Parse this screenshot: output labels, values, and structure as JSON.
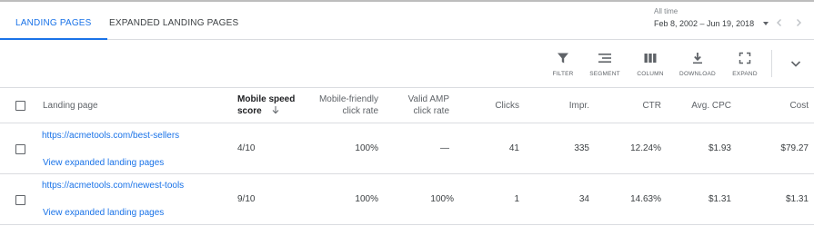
{
  "tabs": [
    {
      "label": "LANDING PAGES",
      "active": true
    },
    {
      "label": "EXPANDED LANDING PAGES",
      "active": false
    }
  ],
  "date_range": {
    "label": "All time",
    "value": "Feb 8, 2002 – Jun 19, 2018"
  },
  "toolbar": {
    "filter": "FILTER",
    "segment": "SEGMENT",
    "column": "COLUMN",
    "download": "DOWNLOAD",
    "expand": "EXPAND"
  },
  "table": {
    "headers": {
      "landing_page": "Landing page",
      "mobile_speed_line1": "Mobile speed",
      "mobile_speed_line2": "score",
      "mobile_friendly_line1": "Mobile-friendly",
      "mobile_friendly_line2": "click rate",
      "valid_amp_line1": "Valid AMP",
      "valid_amp_line2": "click rate",
      "clicks": "Clicks",
      "impr": "Impr.",
      "ctr": "CTR",
      "avg_cpc": "Avg. CPC",
      "cost": "Cost"
    },
    "rows": [
      {
        "url": "https://acmetools.com/best-sellers",
        "expand_link": "View expanded landing pages",
        "mobile_speed": "4/10",
        "mobile_friendly": "100%",
        "valid_amp": "—",
        "clicks": "41",
        "impr": "335",
        "ctr": "12.24%",
        "avg_cpc": "$1.93",
        "cost": "$79.27"
      },
      {
        "url": "https://acmetools.com/newest-tools",
        "expand_link": "View expanded landing pages",
        "mobile_speed": "9/10",
        "mobile_friendly": "100%",
        "valid_amp": "100%",
        "clicks": "1",
        "impr": "34",
        "ctr": "14.63%",
        "avg_cpc": "$1.31",
        "cost": "$1.31"
      }
    ]
  }
}
